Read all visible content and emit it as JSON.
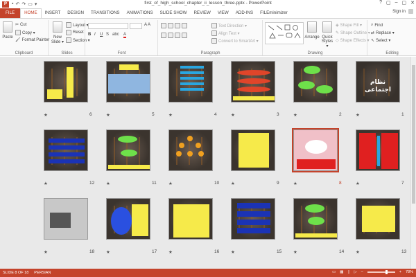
{
  "window": {
    "title": "first_of_high_school_chapter_ii_lesson_three.pptx - PowerPoint",
    "app_icon": "P",
    "controls": [
      "?",
      "▢",
      "–",
      "▢",
      "✕"
    ]
  },
  "tabs": [
    "FILE",
    "HOME",
    "INSERT",
    "DESIGN",
    "TRANSITIONS",
    "ANIMATIONS",
    "SLIDE SHOW",
    "REVIEW",
    "VIEW",
    "ADD-INS",
    "FILEminimizer"
  ],
  "signin": "Sign in",
  "ribbon": {
    "clipboard": {
      "label": "Clipboard",
      "paste": "Paste",
      "cut": "Cut",
      "copy": "Copy ▾",
      "format_painter": "Format Painter"
    },
    "slides": {
      "label": "Slides",
      "new_slide": "New Slide ▾",
      "layout": "Layout ▾",
      "reset": "Reset",
      "section": "Section ▾"
    },
    "font": {
      "label": "Font"
    },
    "paragraph": {
      "label": "Paragraph",
      "text_direction": "Text Direction ▾",
      "align_text": "Align Text ▾",
      "smartart": "Convert to SmartArt ▾"
    },
    "drawing": {
      "label": "Drawing",
      "arrange": "Arrange",
      "quick_styles": "Quick Styles ▾",
      "shape_fill": "Shape Fill ▾",
      "shape_outline": "Shape Outline ▾",
      "shape_effects": "Shape Effects ▾"
    },
    "editing": {
      "label": "Editing",
      "find": "Find",
      "replace": "Replace ▾",
      "select": "Select ▾"
    }
  },
  "slides": [
    {
      "num": "6"
    },
    {
      "num": "5"
    },
    {
      "num": "4"
    },
    {
      "num": "3"
    },
    {
      "num": "2"
    },
    {
      "num": "1",
      "title": "نظام اجتماعی"
    },
    {
      "num": "12"
    },
    {
      "num": "11"
    },
    {
      "num": "10"
    },
    {
      "num": "9"
    },
    {
      "num": "8"
    },
    {
      "num": "7"
    },
    {
      "num": "18"
    },
    {
      "num": "17"
    },
    {
      "num": "16"
    },
    {
      "num": "15"
    },
    {
      "num": "14"
    },
    {
      "num": "13"
    }
  ],
  "status": {
    "slide_of": "SLIDE 8 OF 18",
    "language": "PERSIAN",
    "zoom": "78%"
  },
  "colors": {
    "accent": "#c4432b"
  }
}
